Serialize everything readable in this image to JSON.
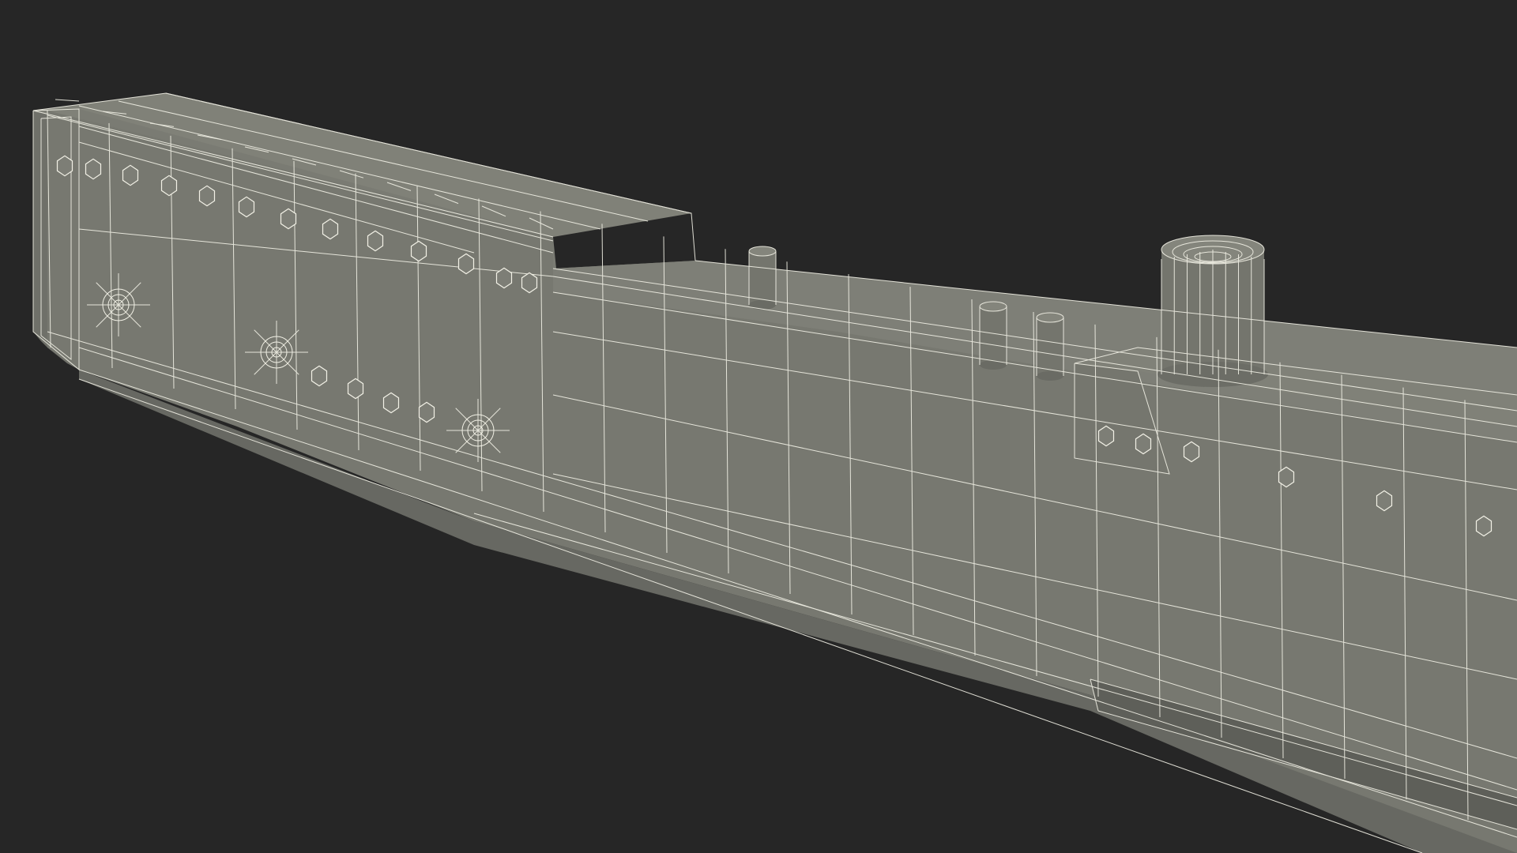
{
  "scene": {
    "background_color": "#262626",
    "model_fill_color": "#777870",
    "model_shadow_color": "#64655e",
    "model_top_color": "#83847b",
    "wireframe_color": "#f2f1e6",
    "subject": "wireframe-3d-rail-beam-model"
  }
}
